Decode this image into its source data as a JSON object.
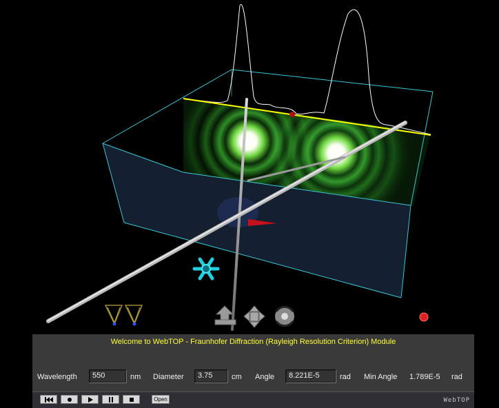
{
  "welcome": "Welcome to WebTOP - Fraunhofer Diffraction (Rayleigh Resolution Criterion) Module",
  "controls": {
    "wavelength": {
      "label": "Wavelength",
      "value": "550",
      "unit": "nm"
    },
    "diameter": {
      "label": "Diameter",
      "value": "3.75",
      "unit": "cm"
    },
    "angle": {
      "label": "Angle",
      "value": "8.221E-5",
      "unit": "rad"
    },
    "min_angle": {
      "label": "Min Angle",
      "value": "1.789E-5",
      "unit": "rad"
    }
  },
  "toolbar": {
    "open_label": "Open",
    "brand": "WebTOP",
    "icons": [
      "skip-back-icon",
      "record-icon",
      "play-icon",
      "pause-icon",
      "stop-icon"
    ]
  },
  "scene_icons": [
    "light-source-icon",
    "light-source-icon",
    "move-vertical-icon",
    "move-planar-icon",
    "rotate-icon",
    "red-ball-icon",
    "cyan-dragger-icon"
  ],
  "colors": {
    "box_edges": "#39c8d8",
    "intensity_line": "#ffff00",
    "ring_glow": "#4fd840",
    "panel_bg": "#3a3a3a",
    "welcome_text": "#ffff33"
  }
}
